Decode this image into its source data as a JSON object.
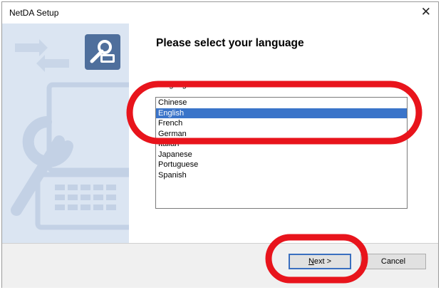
{
  "window": {
    "title": "NetDA Setup",
    "close_glyph": "✕"
  },
  "main": {
    "heading": "Please select your language",
    "language_label": "Language",
    "languages": [
      "Chinese",
      "English",
      "French",
      "German",
      "Italian",
      "Japanese",
      "Portuguese",
      "Spanish"
    ],
    "selected_index": 1
  },
  "footer": {
    "next_label_underlined": "N",
    "next_label_rest": "ext >",
    "cancel_label": "Cancel"
  },
  "colors": {
    "selection": "#3a74c9",
    "sidebar_background": "#dbe5f2",
    "annotation_circle": "#e8141c"
  },
  "icons": [
    "wrench-icon",
    "network-arrows-icon",
    "laptop-icon",
    "close-icon"
  ]
}
